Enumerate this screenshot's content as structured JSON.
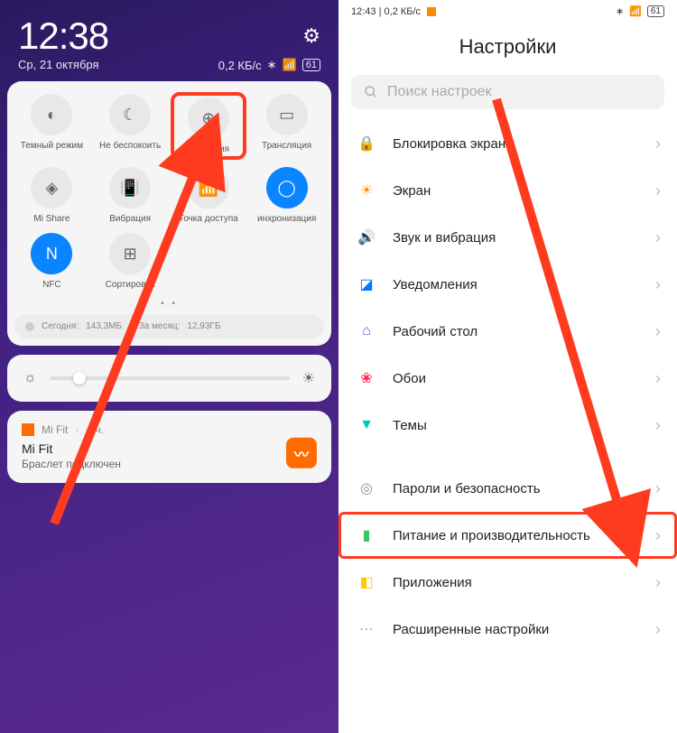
{
  "left": {
    "status": {
      "time": "12:38",
      "date": "Ср, 21 октября",
      "data_rate": "0,2 КБ/с"
    },
    "tiles": [
      {
        "id": "dark-mode",
        "label": "Темный режим",
        "glyph": "◐",
        "on": false
      },
      {
        "id": "dnd",
        "label": "Не беспокоить",
        "glyph": "☾",
        "on": false
      },
      {
        "id": "saver",
        "label": "Экономия",
        "glyph": "⊕",
        "on": false,
        "highlight": true
      },
      {
        "id": "cast",
        "label": "Трансляция",
        "glyph": "▭",
        "on": false
      },
      {
        "id": "mishare",
        "label": "Mi Share",
        "glyph": "◈",
        "on": false
      },
      {
        "id": "vibration",
        "label": "Вибрация",
        "glyph": "📳",
        "on": false
      },
      {
        "id": "hotspot",
        "label": "Точка доступа",
        "glyph": "📶",
        "on": false
      },
      {
        "id": "sync",
        "label": "инхронизация",
        "glyph": "◯",
        "on": true
      },
      {
        "id": "nfc",
        "label": "NFC",
        "glyph": "N",
        "on": true
      },
      {
        "id": "sort",
        "label": "Сортировка",
        "glyph": "⊞",
        "on": false
      }
    ],
    "usage": {
      "today_label": "Сегодня:",
      "today_value": "143,3МБ",
      "month_label": "За месяц:",
      "month_value": "12,93ГБ"
    },
    "notification": {
      "app": "Mi Fit",
      "age": "4 ч.",
      "title": "Mi Fit",
      "body": "Браслет подключен",
      "badge": "〰"
    }
  },
  "right": {
    "status": {
      "time": "12:43",
      "data_rate": "0,2 КБ/с",
      "battery": "61"
    },
    "title": "Настройки",
    "search_placeholder": "Поиск настроек",
    "items": [
      {
        "id": "lock",
        "label": "Блокировка экрана",
        "color": "#ff3b30",
        "glyph": "🔒"
      },
      {
        "id": "display",
        "label": "Экран",
        "color": "#ff9500",
        "glyph": "☀"
      },
      {
        "id": "sound",
        "label": "Звук и вибрация",
        "color": "#34c759",
        "glyph": "🔊"
      },
      {
        "id": "notify",
        "label": "Уведомления",
        "color": "#007aff",
        "glyph": "◪"
      },
      {
        "id": "home",
        "label": "Рабочий стол",
        "color": "#5856d6",
        "glyph": "⌂"
      },
      {
        "id": "wallpaper",
        "label": "Обои",
        "color": "#ff2d55",
        "glyph": "❀"
      },
      {
        "id": "themes",
        "label": "Темы",
        "color": "#00c7be",
        "glyph": "▼"
      },
      {
        "id": "security",
        "label": "Пароли и безопасность",
        "color": "#8e8e93",
        "glyph": "◎"
      },
      {
        "id": "battery",
        "label": "Питание и производительность",
        "color": "#34c759",
        "glyph": "▮",
        "highlight": true
      },
      {
        "id": "apps",
        "label": "Приложения",
        "color": "#ffcc00",
        "glyph": "◧"
      },
      {
        "id": "advanced",
        "label": "Расширенные настройки",
        "color": "#5ac8fa",
        "glyph": "⋯"
      }
    ]
  }
}
